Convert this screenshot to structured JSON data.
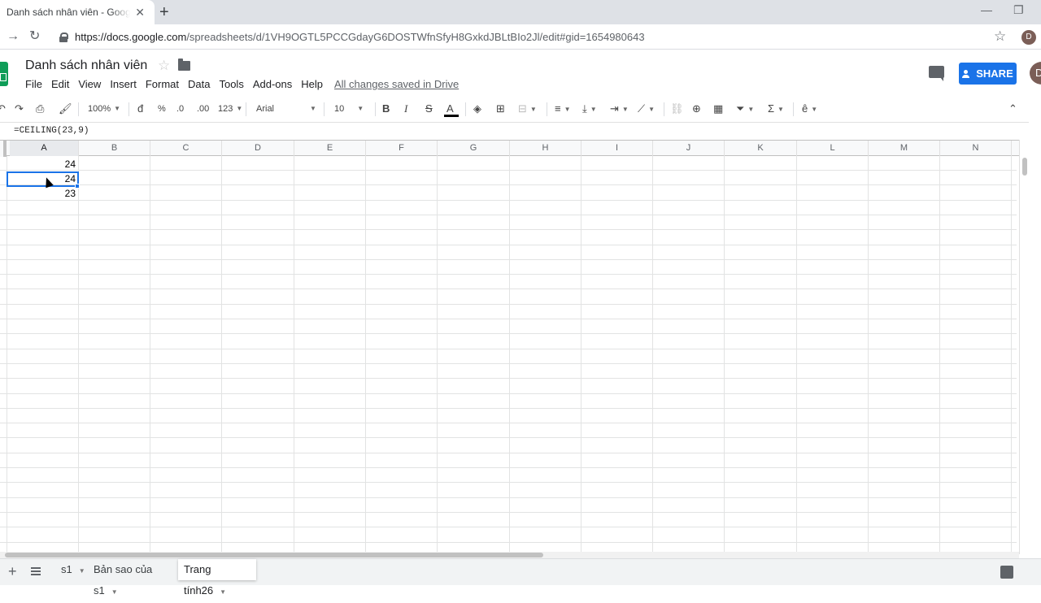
{
  "browser": {
    "tab_title": "Danh sách nhân viên - Google Sheets",
    "tab_close": "✕",
    "new_tab": "+",
    "minimize": "—",
    "restore": "❐",
    "url_host": "https://docs.google.com",
    "url_path": "/spreadsheets/d/1VH9OGTL5PCCGdayG6DOSTWfnSfyH8GxkdJBLtBIo2Jl/edit#gid=1654980643",
    "profile_initial": "D"
  },
  "doc": {
    "title": "Danh sách nhân viên",
    "menu": [
      "File",
      "Edit",
      "View",
      "Insert",
      "Format",
      "Data",
      "Tools",
      "Add-ons",
      "Help"
    ],
    "saved_status": "All changes saved in Drive",
    "share_label": "SHARE",
    "avatar_initial": "D"
  },
  "toolbar": {
    "zoom": "100%",
    "currency": "đ",
    "percent": "%",
    "dec_decrease": ".0",
    "dec_increase": ".00",
    "more_formats": "123",
    "font": "Arial",
    "font_size": "10",
    "bold": "B",
    "italic": "I",
    "strike": "S",
    "text_color": "A",
    "sigma": "Σ",
    "input_tool": "ê"
  },
  "formula": "=CEILING(23,9)",
  "columns": [
    "A",
    "B",
    "C",
    "D",
    "E",
    "F",
    "G",
    "H",
    "I",
    "J",
    "K",
    "L",
    "M",
    "N"
  ],
  "selected_column": "A",
  "cells": {
    "a1": "24",
    "a2": "24",
    "a3": "23"
  },
  "sheets": [
    {
      "name": "s1",
      "active": false
    },
    {
      "name": "Bản sao của s1",
      "active": false
    },
    {
      "name": "Trang tính26",
      "active": true
    }
  ],
  "colors": {
    "accent": "#1a73e8",
    "sheets_green": "#0f9d58"
  }
}
